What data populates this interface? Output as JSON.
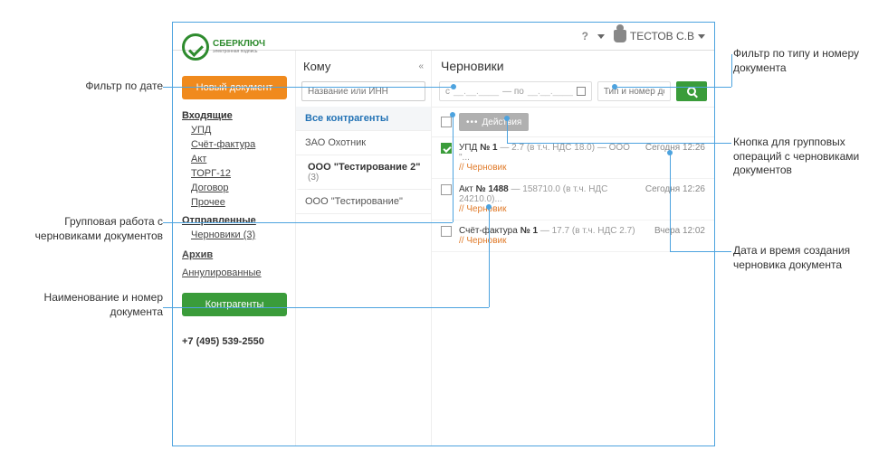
{
  "topbar": {
    "help": "?",
    "user_name": "ТЕСТОВ С.В"
  },
  "logo": {
    "brand": "СБЕРКЛЮЧ",
    "tagline": "электронная подпись"
  },
  "sidebar": {
    "new_doc": "Новый документ",
    "incoming_title": "Входящие",
    "incoming": [
      "УПД",
      "Счёт-фактура",
      "Акт",
      "ТОРГ-12",
      "Договор",
      "Прочее"
    ],
    "outgoing_title": "Отправленные",
    "drafts_label": "Черновики (3)",
    "archive_label": "Архив",
    "voided_label": "Аннулированные",
    "counterparties_btn": "Контрагенты",
    "phone": "+7 (495) 539-2550"
  },
  "mid": {
    "header": "Кому",
    "search_placeholder": "Название или ИНН",
    "items": [
      {
        "label": "Все контрагенты",
        "active": true
      },
      {
        "label": "ЗАО Охотник"
      },
      {
        "label": "ООО \"Тестирование 2\"",
        "sub": "(3)",
        "selected": true
      },
      {
        "label": "ООО \"Тестирование\""
      }
    ]
  },
  "right": {
    "header": "Черновики",
    "date_from_prefix": "с",
    "date_sep": "— по",
    "date_placeholder": "__.__.____",
    "type_placeholder": "Тип и номер документа",
    "actions_btn": "Действия",
    "docs": [
      {
        "title_prefix": "УПД",
        "num": "№ 1",
        "meta": "— 2.7 (в т.ч. НДС 18.0) — ООО \"...",
        "draft": "// Черновик",
        "time": "Сегодня 12:26",
        "checked": true
      },
      {
        "title_prefix": "Акт",
        "num": "№ 1488",
        "meta": "— 158710.0 (в т.ч. НДС 24210.0)...",
        "draft": "// Черновик",
        "time": "Сегодня 12:26"
      },
      {
        "title_prefix": "Счёт-фактура",
        "num": "№ 1",
        "meta": "— 17.7 (в т.ч. НДС 2.7)",
        "draft": "// Черновик",
        "time": "Вчера 12:02"
      }
    ]
  },
  "callouts": {
    "date_filter": "Фильтр по дате",
    "group_work": "Групповая работа с черновиками документов",
    "doc_name_num": "Наименование и номер документа",
    "type_num_filter": "Фильтр по типу и номеру документа",
    "group_ops_btn": "Кнопка для групповых операций с черновиками документов",
    "doc_datetime": "Дата и время создания черновика документа"
  }
}
